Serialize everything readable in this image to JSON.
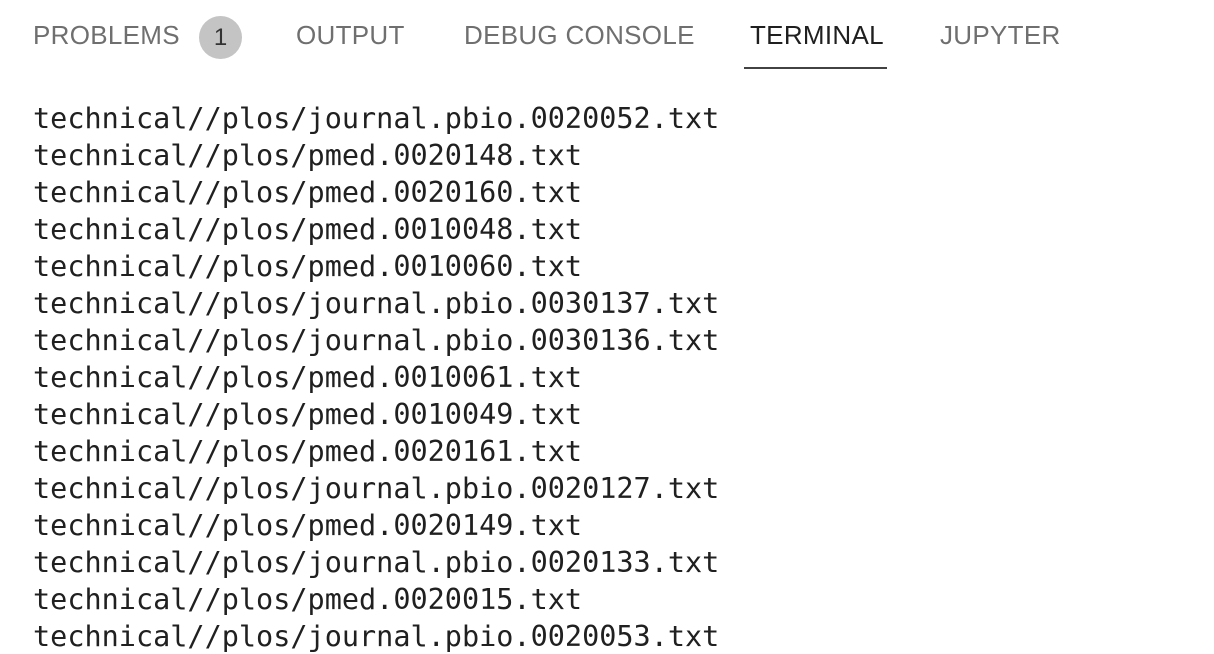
{
  "tabs": {
    "problems": {
      "label": "PROBLEMS",
      "badge": "1"
    },
    "output": {
      "label": "OUTPUT"
    },
    "debug_console": {
      "label": "DEBUG CONSOLE"
    },
    "terminal": {
      "label": "TERMINAL",
      "active": true
    },
    "jupyter": {
      "label": "JUPYTER"
    }
  },
  "terminal": {
    "lines": [
      "technical//plos/journal.pbio.0020052.txt",
      "technical//plos/pmed.0020148.txt",
      "technical//plos/pmed.0020160.txt",
      "technical//plos/pmed.0010048.txt",
      "technical//plos/pmed.0010060.txt",
      "technical//plos/journal.pbio.0030137.txt",
      "technical//plos/journal.pbio.0030136.txt",
      "technical//plos/pmed.0010061.txt",
      "technical//plos/pmed.0010049.txt",
      "technical//plos/pmed.0020161.txt",
      "technical//plos/journal.pbio.0020127.txt",
      "technical//plos/pmed.0020149.txt",
      "technical//plos/journal.pbio.0020133.txt",
      "technical//plos/pmed.0020015.txt",
      "technical//plos/journal.pbio.0020053.txt"
    ]
  }
}
